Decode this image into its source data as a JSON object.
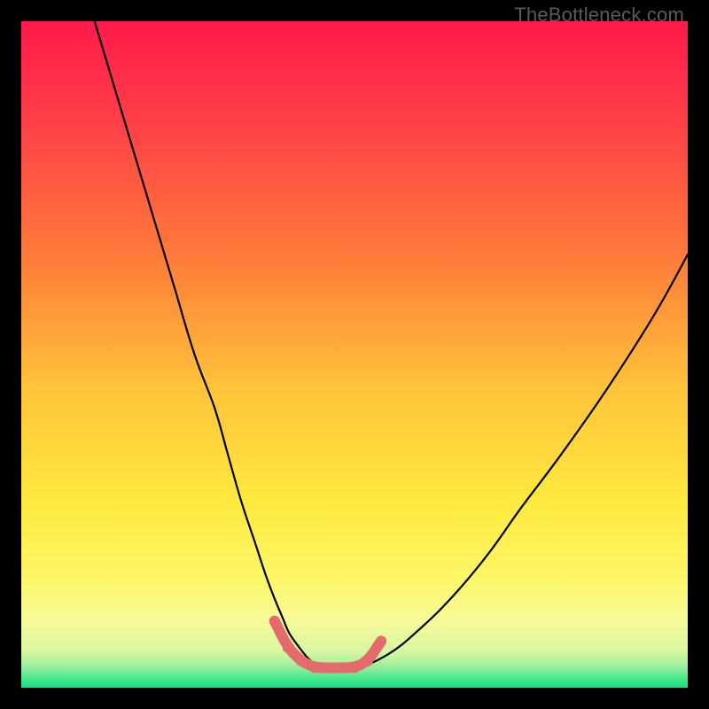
{
  "watermark": "TheBottleneck.com",
  "chart_data": {
    "type": "line",
    "title": "",
    "xlabel": "",
    "ylabel": "",
    "xlim": [
      0,
      100
    ],
    "ylim": [
      0,
      100
    ],
    "grid": false,
    "legend": false,
    "gradient_stops": [
      {
        "offset": 0.0,
        "color": "#ff1a4b"
      },
      {
        "offset": 0.18,
        "color": "#ff4747"
      },
      {
        "offset": 0.35,
        "color": "#ff7a3a"
      },
      {
        "offset": 0.55,
        "color": "#ffc33a"
      },
      {
        "offset": 0.72,
        "color": "#ffe93e"
      },
      {
        "offset": 0.84,
        "color": "#fdf76a"
      },
      {
        "offset": 0.9,
        "color": "#f6fa9a"
      },
      {
        "offset": 0.945,
        "color": "#d8f7a1"
      },
      {
        "offset": 0.965,
        "color": "#a7efa0"
      },
      {
        "offset": 0.985,
        "color": "#4fe88f"
      },
      {
        "offset": 1.0,
        "color": "#12e07f"
      }
    ],
    "series": [
      {
        "name": "bottleneck-curve",
        "stroke": "#000000",
        "stroke_width": 2.2,
        "x": [
          11,
          14,
          17,
          20,
          23,
          26,
          29,
          31,
          33,
          35,
          37,
          39,
          41,
          45,
          50,
          55,
          60,
          65,
          70,
          75,
          81,
          88,
          95,
          100
        ],
        "y": [
          100,
          90,
          80,
          70,
          60,
          50,
          42,
          35,
          28,
          22,
          16,
          11,
          7,
          3,
          3,
          5,
          9,
          14,
          20,
          27,
          35,
          45,
          56,
          65
        ]
      },
      {
        "name": "valley-marker",
        "stroke": "#e46a6d",
        "stroke_width": 12,
        "marker_radius": 6,
        "x": [
          38,
          40,
          42,
          44,
          47,
          50,
          52,
          54
        ],
        "y": [
          10,
          6,
          4,
          3,
          3,
          3,
          4,
          7
        ]
      }
    ]
  }
}
